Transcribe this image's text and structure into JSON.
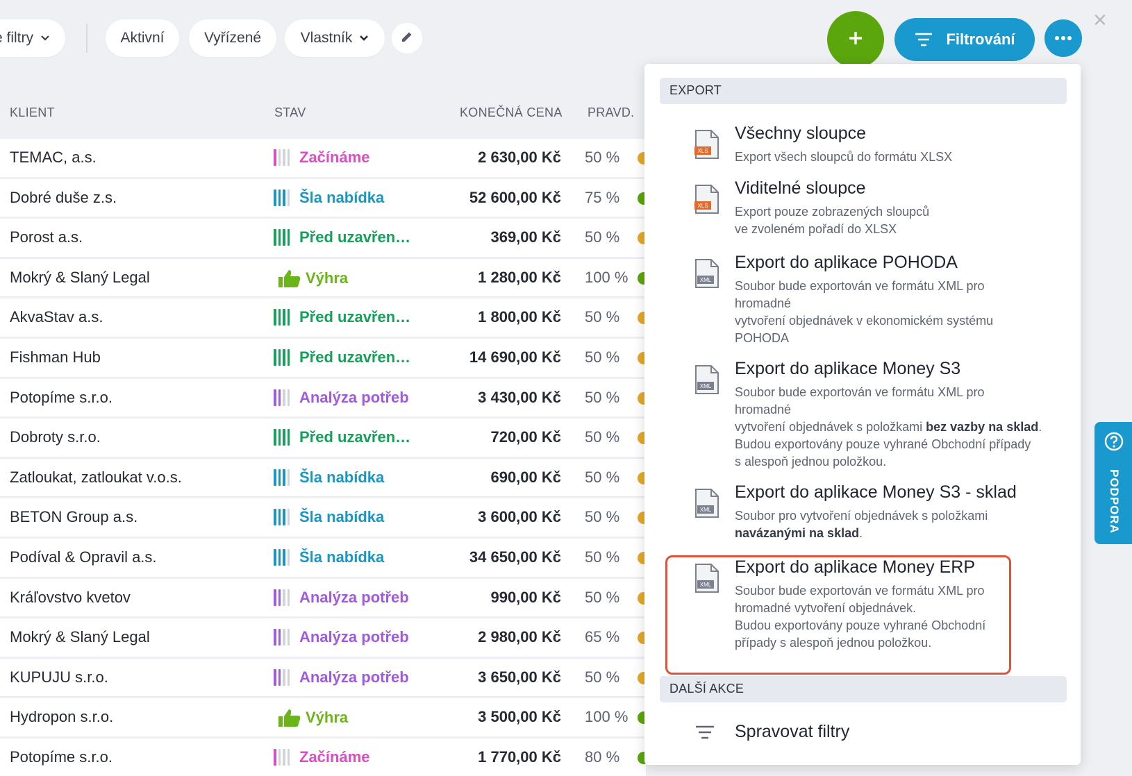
{
  "topbar": {
    "saved_filters_label": "e filtry",
    "active_label": "Aktivní",
    "resolved_label": "Vyřízené",
    "owner_label": "Vlastník",
    "filter_button_label": "Filtrování",
    "close_label": "×"
  },
  "table": {
    "headers": {
      "client": "KLIENT",
      "stage": "STAV",
      "price": "KONEČNÁ CENA",
      "probability": "PRAVD."
    },
    "rows": [
      {
        "client": "TEMAC, a.s.",
        "stage": "Začínáme",
        "price": "2 630,00 Kč",
        "probability": "50 %"
      },
      {
        "client": "Dobré duše z.s.",
        "stage": "Šla nabídka",
        "price": "52 600,00 Kč",
        "probability": "75 %"
      },
      {
        "client": "Porost a.s.",
        "stage": "Před uzavřen…",
        "price": "369,00 Kč",
        "probability": "50 %"
      },
      {
        "client": "Mokrý & Slaný Legal",
        "stage": "Výhra",
        "price": "1 280,00 Kč",
        "probability": "100 %"
      },
      {
        "client": "AkvaStav a.s.",
        "stage": "Před uzavřen…",
        "price": "1 800,00 Kč",
        "probability": "50 %"
      },
      {
        "client": "Fishman Hub",
        "stage": "Před uzavřen…",
        "price": "14 690,00 Kč",
        "probability": "50 %"
      },
      {
        "client": "Potopíme s.r.o.",
        "stage": "Analýza potřeb",
        "price": "3 430,00 Kč",
        "probability": "50 %"
      },
      {
        "client": "Dobroty s.r.o.",
        "stage": "Před uzavřen…",
        "price": "720,00 Kč",
        "probability": "50 %"
      },
      {
        "client": "Zatloukat, zatloukat v.o.s.",
        "stage": "Šla nabídka",
        "price": "690,00 Kč",
        "probability": "50 %"
      },
      {
        "client": "BETON Group a.s.",
        "stage": "Šla nabídka",
        "price": "3 600,00 Kč",
        "probability": "50 %"
      },
      {
        "client": "Podíval & Opravil a.s.",
        "stage": "Šla nabídka",
        "price": "34 650,00 Kč",
        "probability": "50 %"
      },
      {
        "client": "Kráľovstvo kvetov",
        "stage": "Analýza potřeb",
        "price": "990,00 Kč",
        "probability": "50 %"
      },
      {
        "client": "Mokrý & Slaný Legal",
        "stage": "Analýza potřeb",
        "price": "2 980,00 Kč",
        "probability": "65 %"
      },
      {
        "client": "KUPUJU s.r.o.",
        "stage": "Analýza potřeb",
        "price": "3 650,00 Kč",
        "probability": "50 %"
      },
      {
        "client": "Hydropon s.r.o.",
        "stage": "Výhra",
        "price": "3 500,00 Kč",
        "probability": "100 %"
      },
      {
        "client": "Potopíme s.r.o.",
        "stage": "Začínáme",
        "price": "1 770,00 Kč",
        "probability": "80 %"
      }
    ]
  },
  "dropdown": {
    "export_header": "EXPORT",
    "items": [
      {
        "title": "Všechny sloupce",
        "desc": "Export všech sloupců do formátu XLSX",
        "icon": "xls"
      },
      {
        "title": "Viditelné sloupce",
        "desc_1": "Export pouze zobrazených sloupců",
        "desc_2": "ve zvoleném pořadí do XLSX",
        "icon": "xls"
      },
      {
        "title": "Export do aplikace POHODA",
        "desc_1": "Soubor bude exportován ve formátu XML pro",
        "desc_2": "hromadné",
        "desc_3": "vytvoření objednávek v ekonomickém systému",
        "desc_4": "POHODA",
        "icon": "xml"
      },
      {
        "title": "Export do aplikace Money S3",
        "desc_1": "Soubor bude exportován ve formátu XML pro",
        "desc_2": "hromadné",
        "desc_3": "vytvoření objednávek s položkami ",
        "desc_3_bold": "bez vazby na sklad",
        "desc_3_end": ".",
        "desc_4": "Budou exportovány pouze vyhrané Obchodní případy",
        "desc_5": "s alespoň jednou položkou.",
        "icon": "xml"
      },
      {
        "title": "Export do aplikace Money S3 - sklad",
        "desc_1": "Soubor pro vytvoření objednávek s položkami",
        "desc_2_bold": "navázanými na sklad",
        "desc_2_end": ".",
        "icon": "xml"
      },
      {
        "title": "Export do aplikace Money ERP",
        "desc_1": "Soubor bude exportován ve formátu XML pro",
        "desc_2": "hromadné vytvoření objednávek.",
        "desc_3": "Budou exportovány pouze vyhrané Obchodní",
        "desc_4": "případy s alespoň jednou položkou.",
        "icon": "xml"
      }
    ],
    "more_header": "DALŠÍ AKCE",
    "manage_filters": "Spravovat filtry"
  },
  "support": {
    "label": "PODPORA"
  },
  "colors": {
    "accent": "#1a99cf",
    "add": "#5aa60c",
    "highlight": "#e0533a",
    "stage_start": "#d94fc2",
    "stage_offer": "#1a96c2",
    "stage_closing": "#17a05a",
    "stage_win": "#6ab517",
    "stage_analysis": "#a05ae0",
    "dot_yellow": "#e3a82b",
    "dot_green": "#5aa60c"
  }
}
